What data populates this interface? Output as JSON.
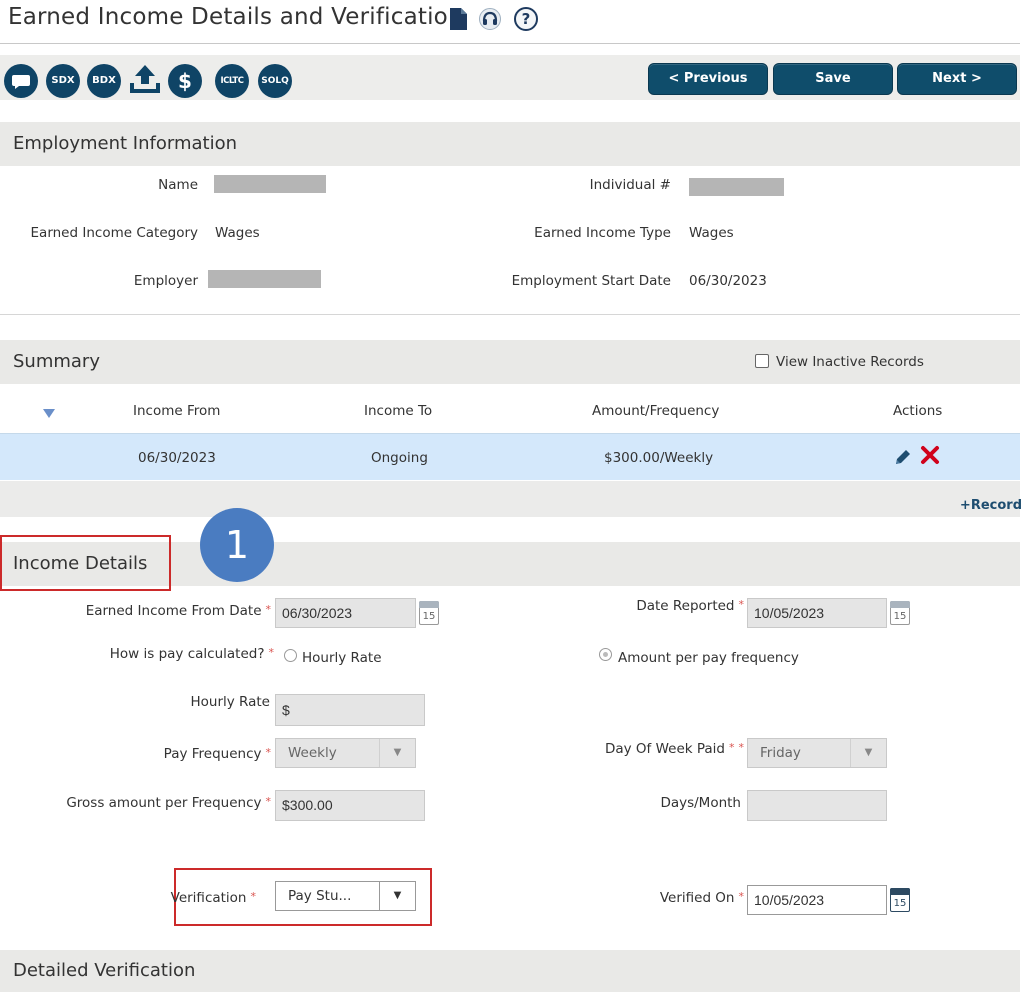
{
  "page": {
    "title": "Earned Income Details and Verification",
    "help_symbol": "?"
  },
  "toolbar": {
    "icons": [
      {
        "name": "chat-icon",
        "label": ""
      },
      {
        "name": "sdx-icon",
        "label": "SDX"
      },
      {
        "name": "bdx-icon",
        "label": "BDX"
      },
      {
        "name": "upload-icon",
        "label": ""
      },
      {
        "name": "dollar-icon",
        "label": "$"
      },
      {
        "name": "icltc-icon",
        "label": "ICLTC"
      },
      {
        "name": "solq-icon",
        "label": "SOLQ"
      }
    ],
    "previous_label": "< Previous",
    "save_label": "Save",
    "next_label": "Next >"
  },
  "employment": {
    "header": "Employment Information",
    "name_label": "Name",
    "individual_label": "Individual #",
    "category_label": "Earned Income Category",
    "category_value": "Wages",
    "type_label": "Earned Income Type",
    "type_value": "Wages",
    "employer_label": "Employer",
    "start_date_label": "Employment Start Date",
    "start_date_value": "06/30/2023"
  },
  "summary": {
    "header": "Summary",
    "view_inactive_label": "View Inactive Records",
    "columns": [
      "Income From",
      "Income To",
      "Amount/Frequency",
      "Actions"
    ],
    "row": {
      "income_from": "06/30/2023",
      "income_to": "Ongoing",
      "amount": "$300.00/Weekly"
    },
    "add_record_label": "+Record"
  },
  "income_details": {
    "header": "Income Details",
    "step_number": "1",
    "from_date_label": "Earned Income From Date",
    "from_date_value": "06/30/2023",
    "date_reported_label": "Date Reported",
    "date_reported_value": "10/05/2023",
    "pay_calc_label": "How is pay calculated?",
    "hourly_rate_option": "Hourly Rate",
    "amount_per_freq_option": "Amount per pay frequency",
    "hourly_rate_label": "Hourly Rate",
    "hourly_rate_value": "$",
    "pay_frequency_label": "Pay Frequency",
    "pay_frequency_value": "Weekly",
    "day_of_week_label": "Day Of Week Paid",
    "day_of_week_value": "Friday",
    "gross_amount_label": "Gross amount per Frequency",
    "gross_amount_value": "$300.00",
    "days_month_label": "Days/Month",
    "days_month_value": "",
    "verification_label": "Verification",
    "verification_value": "Pay Stu...",
    "verified_on_label": "Verified On",
    "verified_on_value": "10/05/2023",
    "calendar_day": "15",
    "required_mark": "*"
  },
  "detailed_verification": {
    "header": "Detailed Verification"
  },
  "colors": {
    "primary_button": "#0f4d6b",
    "selected_row": "#d4e8fb",
    "highlight_red": "#cc2a2a",
    "step_badge": "#4a7cc1",
    "delete_icon": "#d0021b"
  }
}
